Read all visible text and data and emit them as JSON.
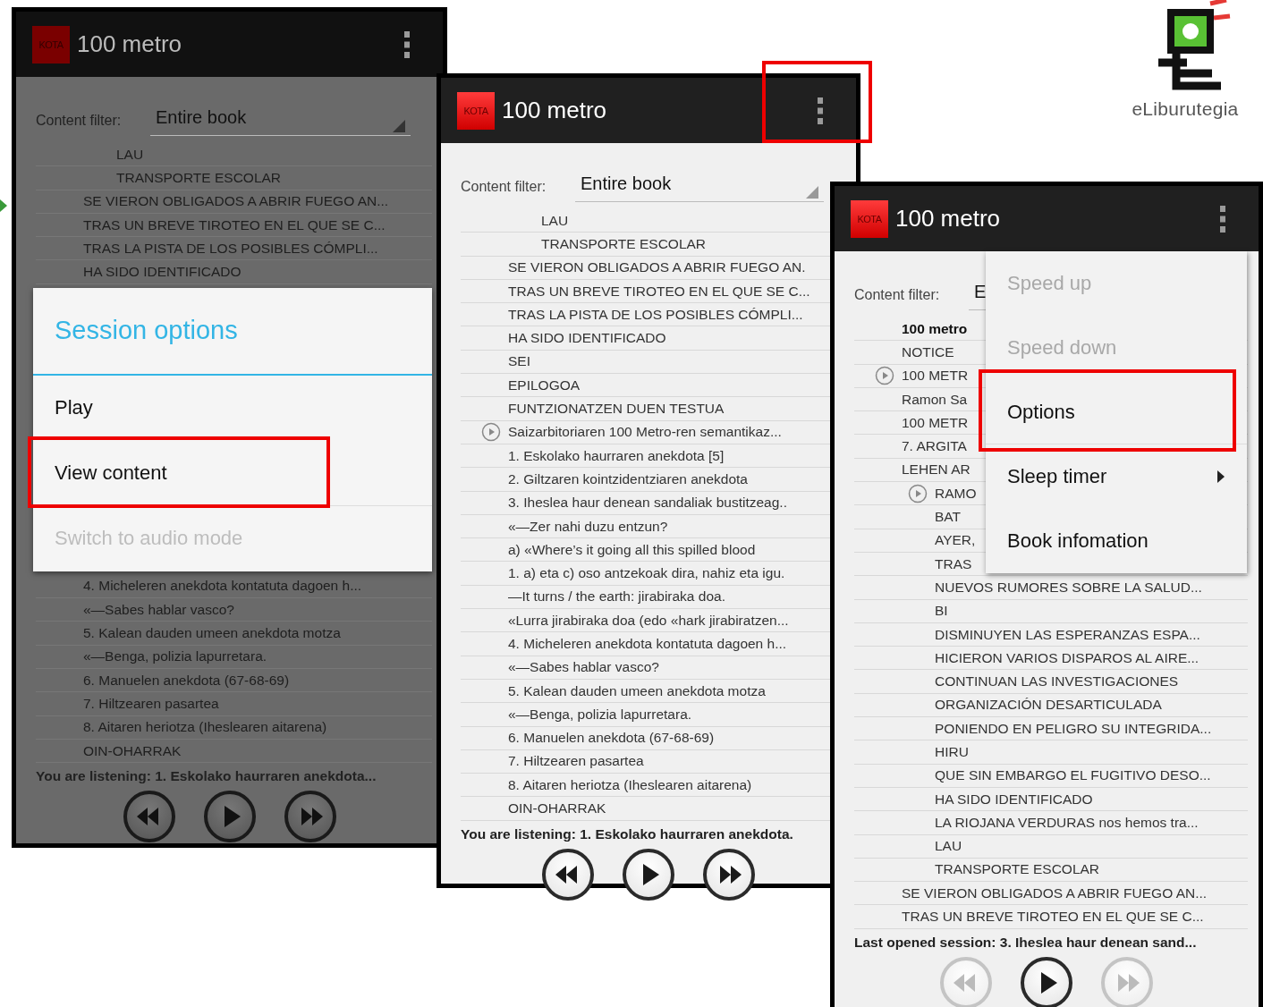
{
  "screens": [
    {
      "app_icon": "KOTA",
      "title": "100 metro",
      "overflow_highlighted": false,
      "dimmed": true,
      "filter": {
        "label": "Content filter:",
        "value": "Entire book"
      },
      "rows": [
        {
          "children": [
            {
              "text": "LAU",
              "bold": false,
              "audio": false
            },
            {
              "text": "TRANSPORTE ESCOLAR",
              "bold": false,
              "audio": false
            }
          ]
        },
        {
          "text": "SE VIERON OBLIGADOS A ABRIR FUEGO AN...",
          "bold": false,
          "audio": false
        },
        {
          "text": "TRAS UN BREVE TIROTEO EN EL QUE SE C...",
          "bold": false,
          "audio": false
        },
        {
          "text": "TRAS LA PISTA DE LOS POSIBLES CÓMPLI...",
          "bold": false,
          "audio": false
        },
        {
          "text": "HA SIDO IDENTIFICADO",
          "bold": false,
          "audio": false
        }
      ],
      "dialog": {
        "title": "Session options",
        "items": [
          {
            "label": "Play",
            "disabled": false,
            "highlighted": false
          },
          {
            "label": "View content",
            "disabled": false,
            "highlighted": true
          },
          {
            "label": "Switch to audio mode",
            "disabled": true,
            "highlighted": false
          }
        ]
      },
      "rows_below": [
        {
          "text": "4. Micheleren anekdota kontatuta dagoen h...",
          "bold": false,
          "audio": false
        },
        {
          "text": "«—Sabes hablar vasco?",
          "bold": false,
          "audio": false
        },
        {
          "text": "5. Kalean dauden umeen anekdota motza",
          "bold": false,
          "audio": false
        },
        {
          "text": "«—Benga, polizia lapurretara.",
          "bold": false,
          "audio": false
        },
        {
          "text": "6. Manuelen anekdota (67-68-69)",
          "bold": false,
          "audio": false
        },
        {
          "text": "7. Hiltzearen pasartea",
          "bold": false,
          "audio": false
        },
        {
          "text": "8. Aitaren heriotza (Iheslearen aitarena)",
          "bold": false,
          "audio": false
        },
        {
          "text": "OIN-OHARRAK",
          "bold": false,
          "audio": false
        }
      ],
      "status": "You are listening: 1. Eskolako haurraren anekdota...",
      "controls": [
        {
          "kind": "rewind",
          "disabled": false
        },
        {
          "kind": "play",
          "disabled": false
        },
        {
          "kind": "forward",
          "disabled": false
        }
      ]
    },
    {
      "app_icon": "KOTA",
      "title": "100 metro",
      "overflow_highlighted": true,
      "dimmed": false,
      "filter": {
        "label": "Content filter:",
        "value": "Entire book"
      },
      "rows": [
        {
          "children": [
            {
              "text": "LAU",
              "bold": false,
              "audio": false
            },
            {
              "text": "TRANSPORTE ESCOLAR",
              "bold": false,
              "audio": false
            }
          ]
        },
        {
          "text": "SE VIERON OBLIGADOS A ABRIR FUEGO AN.",
          "bold": false,
          "audio": false
        },
        {
          "text": "TRAS UN BREVE TIROTEO EN EL QUE SE C...",
          "bold": false,
          "audio": false
        },
        {
          "text": "TRAS LA PISTA DE LOS POSIBLES CÓMPLI...",
          "bold": false,
          "audio": false
        },
        {
          "text": "HA SIDO IDENTIFICADO",
          "bold": false,
          "audio": false
        },
        {
          "text": "SEI",
          "bold": false,
          "audio": false
        },
        {
          "text": "EPILOGOA",
          "bold": false,
          "audio": false
        },
        {
          "text": "FUNTZIONATZEN DUEN TESTUA",
          "bold": false,
          "audio": false
        },
        {
          "text": "Saizarbitoriaren 100 Metro-ren semantikaz...",
          "bold": false,
          "audio": true
        },
        {
          "text": "1. Eskolako haurraren anekdota [5]",
          "bold": false,
          "audio": false
        },
        {
          "text": "2. Giltzaren kointzidentziaren anekdota",
          "bold": false,
          "audio": false
        },
        {
          "text": "3. Iheslea haur denean sandaliak bustitzeag..",
          "bold": false,
          "audio": false
        },
        {
          "text": "«—Zer nahi duzu entzun?",
          "bold": false,
          "audio": false
        },
        {
          "text": "a) «Where’s it going all this spilled blood",
          "bold": false,
          "audio": false
        },
        {
          "text": "1. a) eta c) oso antzekoak dira, nahiz eta igu.",
          "bold": false,
          "audio": false
        },
        {
          "text": "—It turns / the earth: jirabiraka doa.",
          "bold": false,
          "audio": false
        },
        {
          "text": "«Lurra jirabiraka doa (edo «hark jirabiratzen...",
          "bold": false,
          "audio": false
        },
        {
          "text": "4. Micheleren anekdota kontatuta dagoen h...",
          "bold": false,
          "audio": false
        },
        {
          "text": "«—Sabes hablar vasco?",
          "bold": false,
          "audio": false
        },
        {
          "text": "5. Kalean dauden umeen anekdota motza",
          "bold": false,
          "audio": false
        },
        {
          "text": "«—Benga, polizia lapurretara.",
          "bold": false,
          "audio": false
        },
        {
          "text": "6. Manuelen anekdota (67-68-69)",
          "bold": false,
          "audio": false
        },
        {
          "text": "7. Hiltzearen pasartea",
          "bold": false,
          "audio": false
        },
        {
          "text": "8. Aitaren heriotza (Iheslearen aitarena)",
          "bold": false,
          "audio": false
        },
        {
          "text": "OIN-OHARRAK",
          "bold": false,
          "audio": false
        }
      ],
      "status": "You are listening: 1. Eskolako haurraren anekdota.",
      "controls": [
        {
          "kind": "rewind",
          "disabled": false
        },
        {
          "kind": "play",
          "disabled": false
        },
        {
          "kind": "forward",
          "disabled": false
        }
      ]
    },
    {
      "app_icon": "KOTA",
      "title": "100 metro",
      "overflow_highlighted": false,
      "dimmed": false,
      "filter": {
        "label": "Content filter:",
        "value": "E"
      },
      "rows": [
        {
          "text": "100 metro",
          "bold": true,
          "audio": false
        },
        {
          "text": "NOTICE",
          "bold": false,
          "audio": false
        },
        {
          "text": "100 METR",
          "bold": false,
          "audio": true
        },
        {
          "text": "Ramon Sa",
          "bold": false,
          "audio": false
        },
        {
          "text": "100 METR",
          "bold": false,
          "audio": false
        },
        {
          "text": "7. ARGITA",
          "bold": false,
          "audio": false
        },
        {
          "text": "LEHEN AR",
          "bold": false,
          "audio": false,
          "children": [
            {
              "text": "RAMO",
              "bold": false,
              "audio": true
            },
            {
              "text": "BAT",
              "bold": false,
              "audio": false
            },
            {
              "text": "AYER,",
              "bold": false,
              "audio": false
            },
            {
              "text": "TRAS",
              "bold": false,
              "audio": false
            },
            {
              "text": "NUEVOS RUMORES SOBRE LA SALUD...",
              "bold": false,
              "audio": false
            },
            {
              "text": "BI",
              "bold": false,
              "audio": false
            },
            {
              "text": "DISMINUYEN LAS ESPERANZAS ESPA...",
              "bold": false,
              "audio": false
            },
            {
              "text": "HICIERON VARIOS DISPAROS AL AIRE...",
              "bold": false,
              "audio": false
            },
            {
              "text": "CONTINUAN LAS INVESTIGACIONES",
              "bold": false,
              "audio": false
            },
            {
              "text": "ORGANIZACIÓN DESARTICULADA",
              "bold": false,
              "audio": false
            },
            {
              "text": "PONIENDO EN PELIGRO SU INTEGRIDA...",
              "bold": false,
              "audio": false
            },
            {
              "text": "HIRU",
              "bold": false,
              "audio": false
            },
            {
              "text": "QUE SIN EMBARGO EL FUGITIVO DESO...",
              "bold": false,
              "audio": false
            },
            {
              "text": "HA SIDO IDENTIFICADO",
              "bold": false,
              "audio": false
            },
            {
              "text": "LA RIOJANA VERDURAS nos hemos tra...",
              "bold": false,
              "audio": false
            },
            {
              "text": "LAU",
              "bold": false,
              "audio": false
            },
            {
              "text": "TRANSPORTE ESCOLAR",
              "bold": false,
              "audio": false
            }
          ]
        },
        {
          "text": "SE VIERON OBLIGADOS A ABRIR FUEGO AN...",
          "bold": false,
          "audio": false
        },
        {
          "text": "TRAS UN BREVE TIROTEO EN EL QUE SE C...",
          "bold": false,
          "audio": false
        }
      ],
      "menu": [
        {
          "label": "Speed up",
          "disabled": true,
          "submenu": false,
          "highlighted": false
        },
        {
          "label": "Speed down",
          "disabled": true,
          "submenu": false,
          "highlighted": false
        },
        {
          "label": "Options",
          "disabled": false,
          "submenu": false,
          "highlighted": true
        },
        {
          "label": "Sleep timer",
          "disabled": false,
          "submenu": true,
          "highlighted": false
        },
        {
          "label": "Book infomation",
          "disabled": false,
          "submenu": false,
          "highlighted": false
        }
      ],
      "status": "Last opened session: 3. Iheslea haur denean sand...",
      "controls": [
        {
          "kind": "rewind",
          "disabled": true
        },
        {
          "kind": "play",
          "disabled": false
        },
        {
          "kind": "forward",
          "disabled": true
        }
      ]
    }
  ],
  "logo": {
    "text": "eLiburutegia"
  }
}
